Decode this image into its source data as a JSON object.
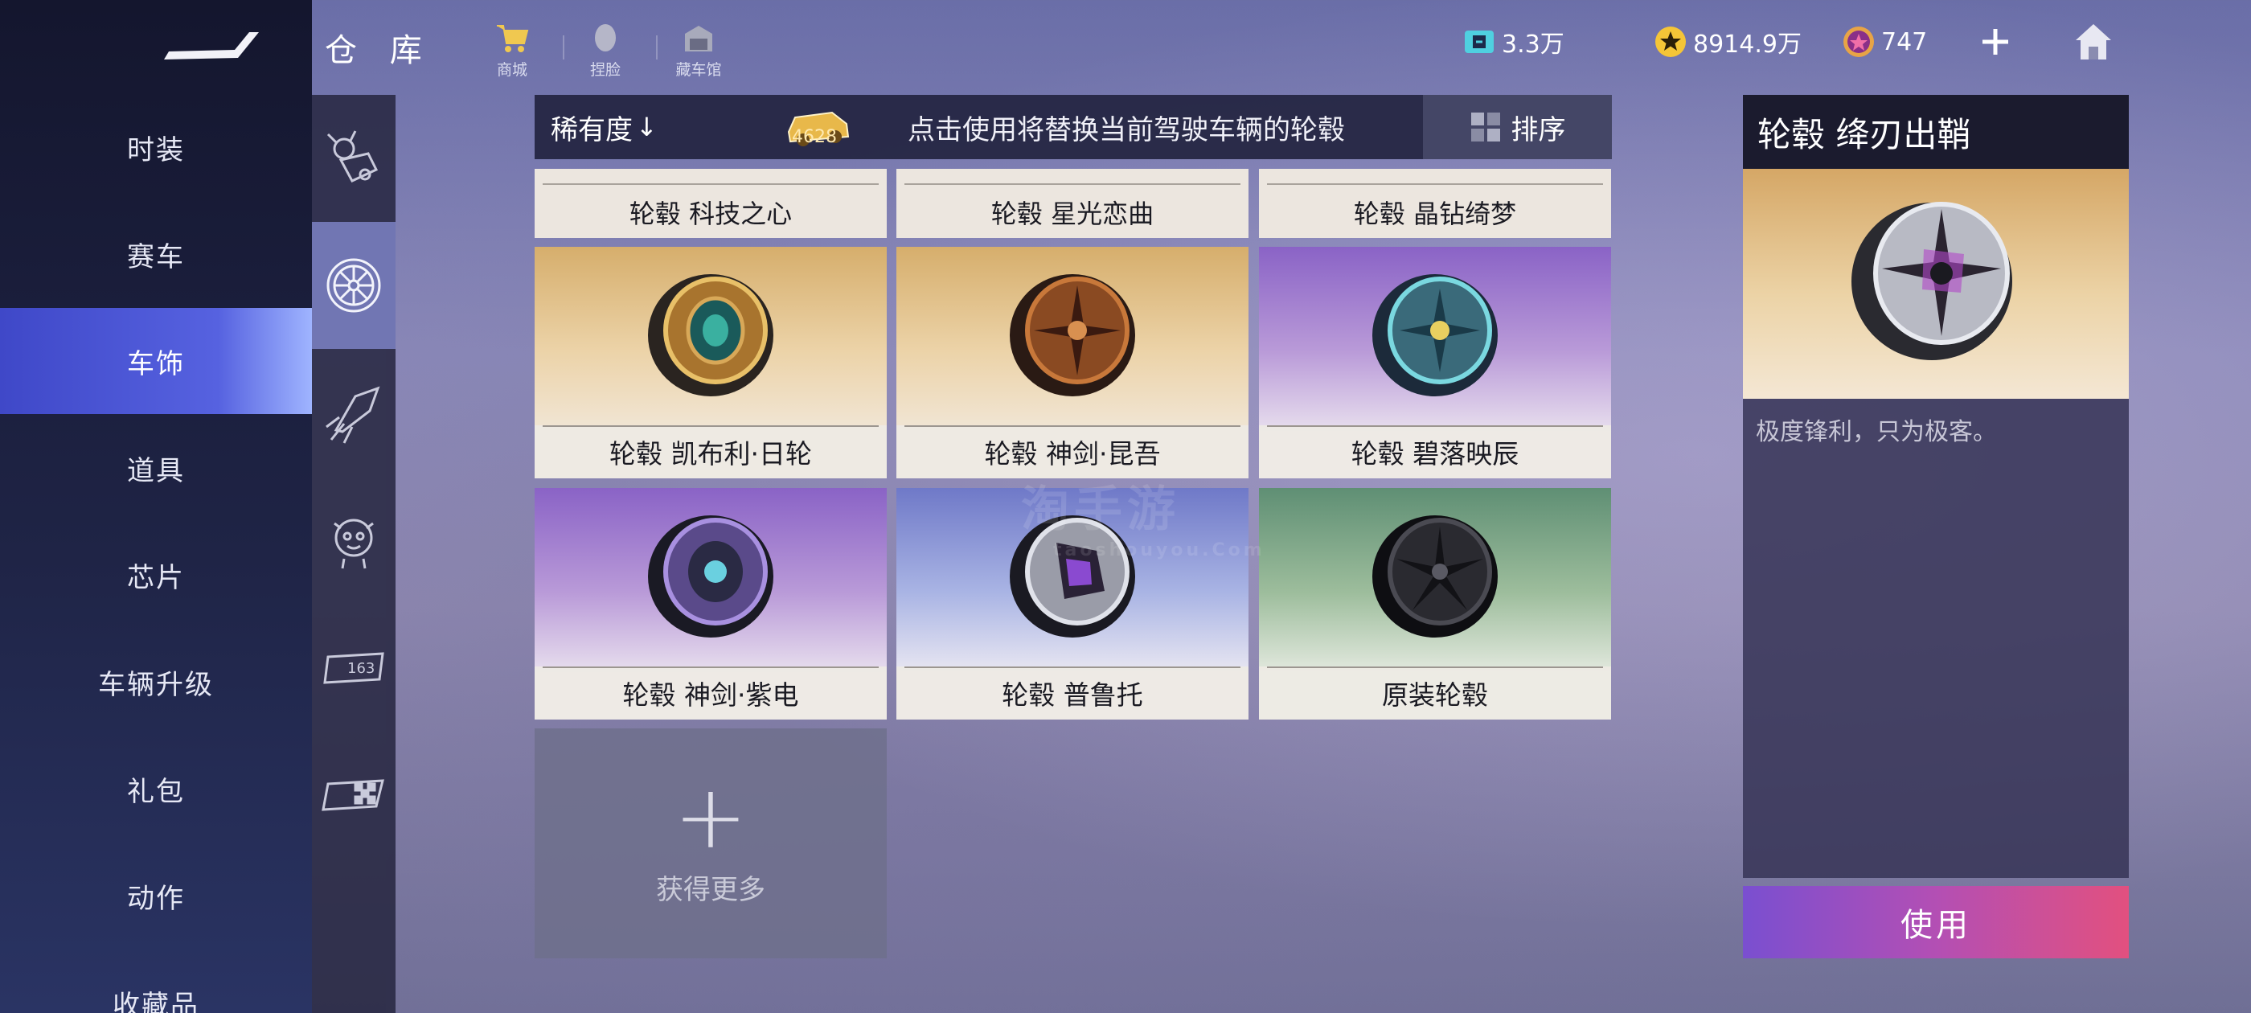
{
  "header": {
    "title": "仓 库",
    "quick_links": [
      {
        "label": "商城",
        "icon": "shop-cart-icon"
      },
      {
        "label": "捏脸",
        "icon": "face-icon"
      },
      {
        "label": "藏车馆",
        "icon": "garage-icon"
      }
    ],
    "currencies": [
      {
        "icon": "coupon-icon",
        "value": "3.3万",
        "color": "#4fd0e0"
      },
      {
        "icon": "star-coin-icon",
        "value": "8914.9万",
        "color": "#f5c537"
      },
      {
        "icon": "diamond-coin-icon",
        "value": "747",
        "color": "#d8557a"
      }
    ]
  },
  "nav": {
    "items": [
      "时装",
      "赛车",
      "车饰",
      "道具",
      "芯片",
      "车辆升级",
      "礼包",
      "动作",
      "收藏品"
    ],
    "active_index": 2
  },
  "categories": {
    "icons": [
      "pet-icon",
      "wheel-icon",
      "booster-icon",
      "mascot-icon",
      "license-plate-icon",
      "flag-icon"
    ],
    "active_index": 1
  },
  "toolbar": {
    "rarity_label": "稀有度",
    "rarity_arrow": "↓",
    "car_badge_value": "4628",
    "hint": "点击使用将替换当前驾驶车辆的轮毂",
    "sort_label": "排序"
  },
  "top_labels": [
    "轮毂 科技之心",
    "轮毂 星光恋曲",
    "轮毂 晶钻绮梦"
  ],
  "items": [
    {
      "name": "轮毂 凯布利·日轮",
      "bg": "gold"
    },
    {
      "name": "轮毂 神剑·昆吾",
      "bg": "gold"
    },
    {
      "name": "轮毂 碧落映辰",
      "bg": "purple"
    },
    {
      "name": "轮毂 神剑·紫电",
      "bg": "purple"
    },
    {
      "name": "轮毂 普鲁托",
      "bg": "blue"
    },
    {
      "name": "原装轮毂",
      "bg": "green"
    }
  ],
  "get_more": {
    "label": "获得更多"
  },
  "detail": {
    "title": "轮毂 绛刃出鞘",
    "description": "极度锋利，只为极客。",
    "use_label": "使用"
  },
  "watermark": {
    "main": "淘手游",
    "sub": "taoshouyou.Com"
  }
}
